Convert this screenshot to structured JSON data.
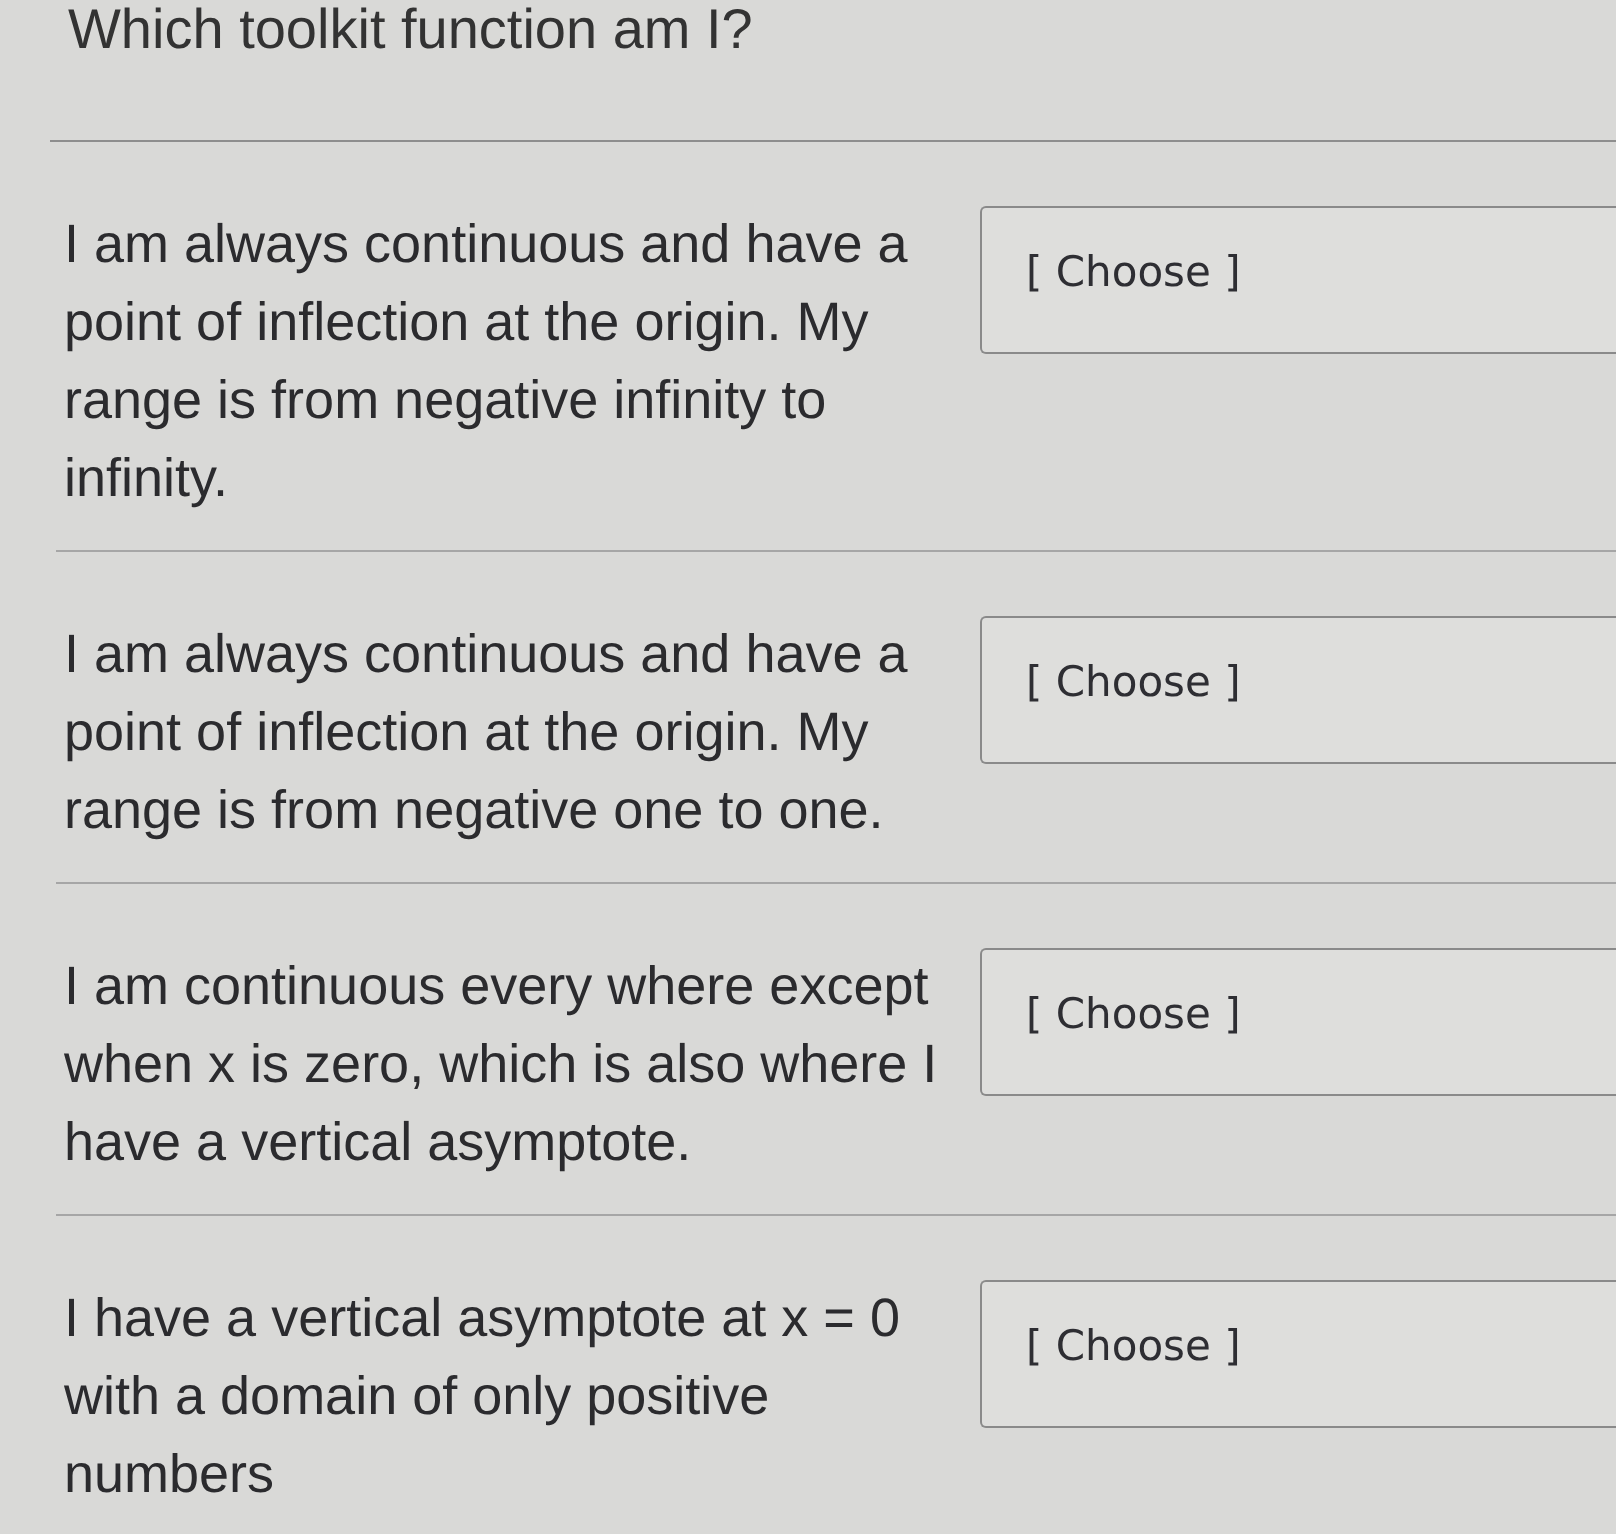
{
  "title": "Which toolkit function am I?",
  "questions": [
    {
      "prompt": "I am always continuous and have a point of inflection at the origin. My range is from negative infinity to infinity.",
      "answer": "[ Choose ]"
    },
    {
      "prompt": "I am always continuous and have a point of inflection at the origin. My range is from negative one to one.",
      "answer": "[ Choose ]"
    },
    {
      "prompt": "I am continuous every where except when x is zero, which is also where I have a vertical asymptote.",
      "answer": "[ Choose ]"
    },
    {
      "prompt": "I have a vertical asymptote at x = 0 with a domain of only positive numbers",
      "answer": "[ Choose ]"
    }
  ]
}
